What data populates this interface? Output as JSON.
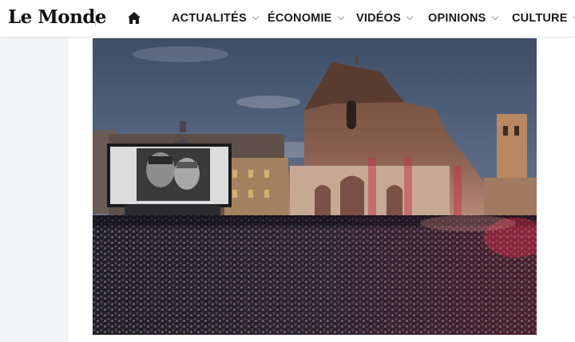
{
  "header": {
    "logo_text": "Le Monde",
    "home_icon": "home-icon",
    "nav_items": [
      {
        "label": "ACTUALITÉS"
      },
      {
        "label": "ÉCONOMIE"
      },
      {
        "label": "VIDÉOS"
      },
      {
        "label": "OPINIONS"
      },
      {
        "label": "CULTURE"
      }
    ]
  },
  "colors": {
    "text": "#1a1a1a",
    "chevron": "#9a9a9a",
    "gutter": "#f3f4f6"
  }
}
